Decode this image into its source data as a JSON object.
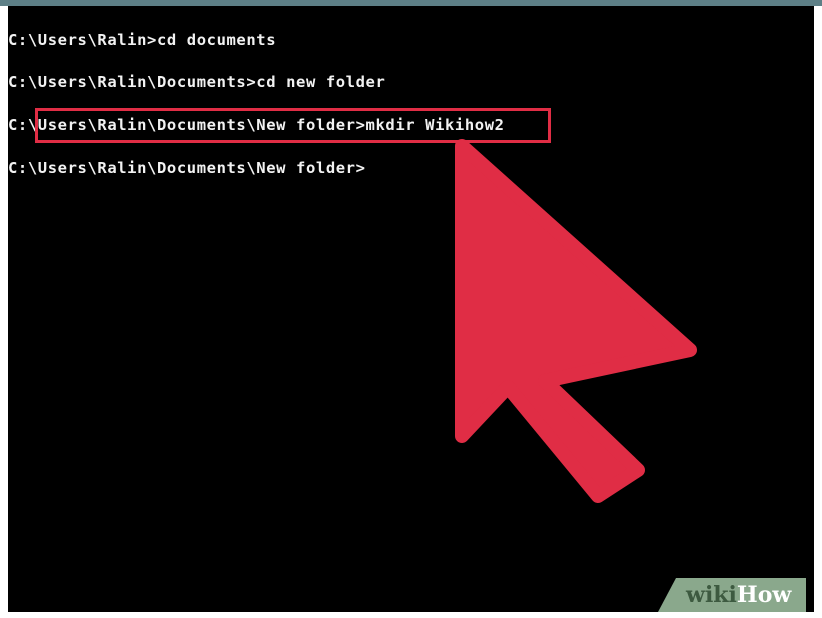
{
  "console": {
    "lines": [
      "C:\\Users\\Ralin>cd documents",
      "C:\\Users\\Ralin\\Documents>cd new folder",
      "C:\\Users\\Ralin\\Documents\\New folder>mkdir Wikihow2",
      "C:\\Users\\Ralin\\Documents\\New folder>"
    ],
    "background": "#000000",
    "text_color": "#f2f2f2"
  },
  "annotation": {
    "highlight_color": "#e02d45",
    "arrow_color": "#e02d45",
    "arrow_icon": "pointer-arrow-icon"
  },
  "watermark": {
    "part1": "wiki",
    "part2": "How",
    "background": "#8aa88c"
  }
}
